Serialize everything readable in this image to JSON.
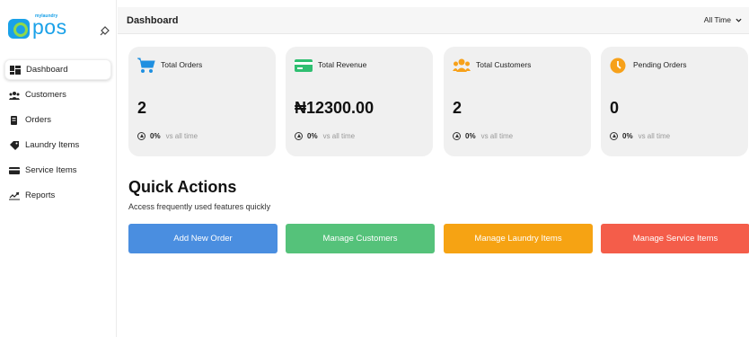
{
  "brand": {
    "small": "mylaundry",
    "big": "pos",
    "colors": {
      "primary": "#1aa1e8",
      "accent": "#8fd94a"
    }
  },
  "sidebar": {
    "items": [
      {
        "label": "Dashboard",
        "icon": "dashboard-icon",
        "active": true
      },
      {
        "label": "Customers",
        "icon": "users-icon",
        "active": false
      },
      {
        "label": "Orders",
        "icon": "orders-icon",
        "active": false
      },
      {
        "label": "Laundry Items",
        "icon": "tag-icon",
        "active": false
      },
      {
        "label": "Service Items",
        "icon": "card-icon",
        "active": false
      },
      {
        "label": "Reports",
        "icon": "trend-icon",
        "active": false
      }
    ]
  },
  "header": {
    "title": "Dashboard",
    "period": "All Time"
  },
  "stats": [
    {
      "title": "Total Orders",
      "value": "2",
      "change": "0%",
      "compare": "vs all time",
      "icon": "cart-icon"
    },
    {
      "title": "Total Revenue",
      "value": "₦12300.00",
      "change": "0%",
      "compare": "vs all time",
      "icon": "credit-card-icon"
    },
    {
      "title": "Total Customers",
      "value": "2",
      "change": "0%",
      "compare": "vs all time",
      "icon": "customers-icon"
    },
    {
      "title": "Pending Orders",
      "value": "0",
      "change": "0%",
      "compare": "vs all time",
      "icon": "clock-icon"
    }
  ],
  "quick_actions": {
    "title": "Quick Actions",
    "subtitle": "Access frequently used features quickly",
    "buttons": [
      {
        "label": "Add New Order",
        "color": "#4a8ee0"
      },
      {
        "label": "Manage Customers",
        "color": "#55c27a"
      },
      {
        "label": "Manage Laundry Items",
        "color": "#f6a313"
      },
      {
        "label": "Manage Service Items",
        "color": "#f45d4a"
      }
    ]
  }
}
